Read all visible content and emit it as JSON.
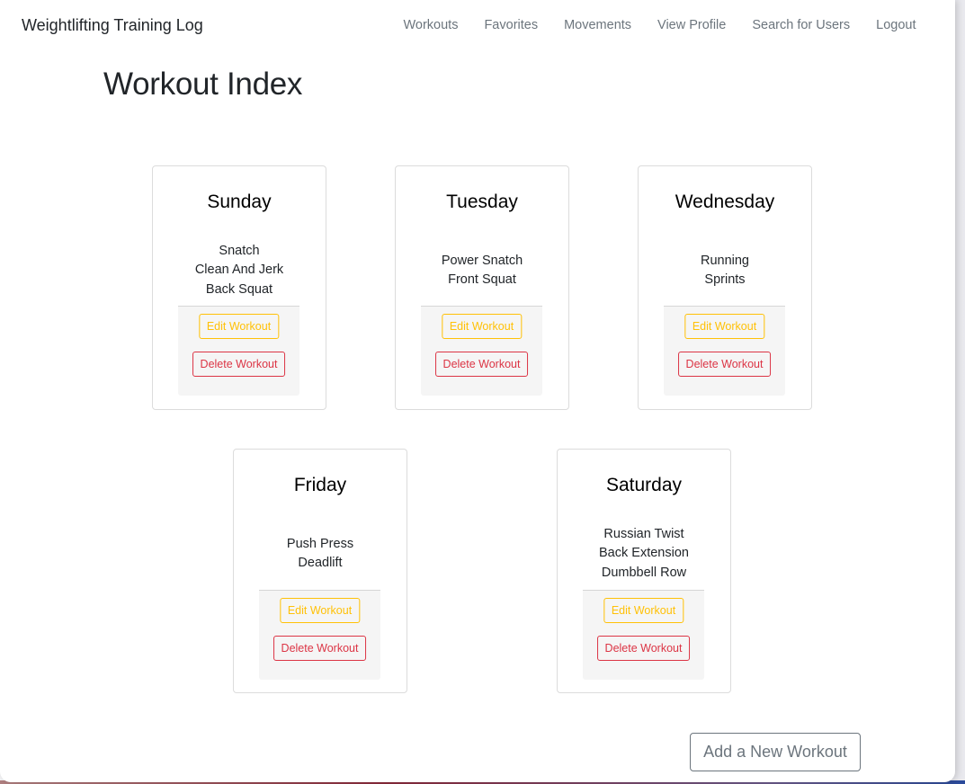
{
  "navbar": {
    "brand": "Weightlifting Training Log",
    "links": [
      "Workouts",
      "Favorites",
      "Movements",
      "View Profile",
      "Search for Users",
      "Logout"
    ]
  },
  "page": {
    "title": "Workout Index",
    "add_button": "Add a New Workout"
  },
  "workouts": [
    {
      "day": "Sunday",
      "movements": [
        "Snatch",
        "Clean And Jerk",
        "Back Squat"
      ],
      "edit_label": "Edit Workout",
      "delete_label": "Delete Workout"
    },
    {
      "day": "Tuesday",
      "movements": [
        "Power Snatch",
        "Front Squat"
      ],
      "edit_label": "Edit Workout",
      "delete_label": "Delete Workout"
    },
    {
      "day": "Wednesday",
      "movements": [
        "Running",
        "Sprints"
      ],
      "edit_label": "Edit Workout",
      "delete_label": "Delete Workout"
    },
    {
      "day": "Friday",
      "movements": [
        "Push Press",
        "Deadlift"
      ],
      "edit_label": "Edit Workout",
      "delete_label": "Delete Workout"
    },
    {
      "day": "Saturday",
      "movements": [
        "Russian Twist",
        "Back Extension",
        "Dumbbell Row"
      ],
      "edit_label": "Edit Workout",
      "delete_label": "Delete Workout"
    }
  ],
  "colors": {
    "edit": "#ffc107",
    "delete": "#dc3545",
    "secondary": "#6c757d"
  }
}
